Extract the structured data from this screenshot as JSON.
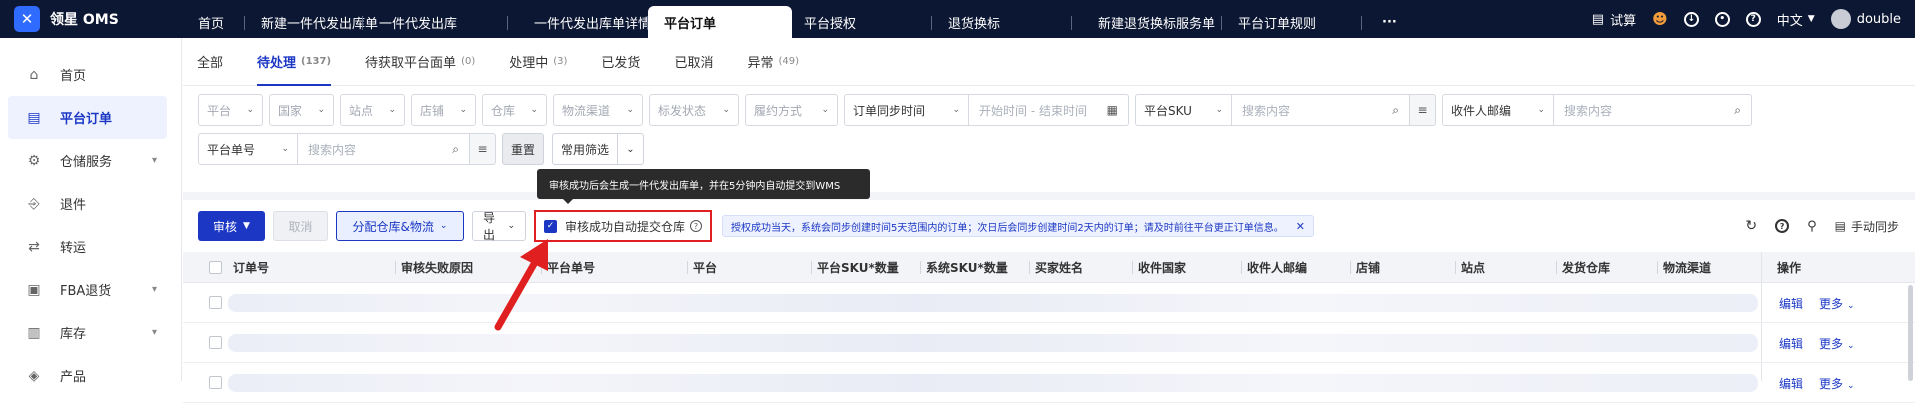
{
  "app": {
    "name": "领星 OMS",
    "logo_icon": "lingxing-logo-icon"
  },
  "topbar": {
    "tabs": [
      "首页",
      "新建一件代发出库单",
      "一件代发出库",
      "一件代发出库单详情",
      "平台订单",
      "平台授权",
      "退货换标",
      "新建退货换标服务单",
      "平台订单规则",
      "···"
    ],
    "active_tab": "平台订单",
    "trial_label": "试算",
    "lang_label": "中文",
    "user_name": "double"
  },
  "sidebar": {
    "items": [
      {
        "label": "首页",
        "icon": "home-icon",
        "expandable": false
      },
      {
        "label": "平台订单",
        "icon": "document-icon",
        "expandable": false,
        "active": true
      },
      {
        "label": "仓储服务",
        "icon": "warehouse-icon",
        "expandable": true
      },
      {
        "label": "退件",
        "icon": "return-icon",
        "expandable": false
      },
      {
        "label": "转运",
        "icon": "transfer-icon",
        "expandable": false
      },
      {
        "label": "FBA退货",
        "icon": "fba-icon",
        "expandable": true
      },
      {
        "label": "库存",
        "icon": "stock-icon",
        "expandable": true
      },
      {
        "label": "产品",
        "icon": "product-icon",
        "expandable": false
      }
    ]
  },
  "status_tabs": [
    {
      "label": "全部",
      "count": ""
    },
    {
      "label": "待处理",
      "count": "(137)",
      "active": true
    },
    {
      "label": "待获取平台面单",
      "count": "(0)"
    },
    {
      "label": "处理中",
      "count": "(3)"
    },
    {
      "label": "已发货",
      "count": ""
    },
    {
      "label": "已取消",
      "count": ""
    },
    {
      "label": "异常",
      "count": "(49)"
    }
  ],
  "filters": {
    "platform": "平台",
    "country": "国家",
    "site": "站点",
    "store": "店铺",
    "warehouse": "仓库",
    "logistics": "物流渠道",
    "label_status": "标发状态",
    "fulfill_method": "履约方式",
    "sync_time": "订单同步时间",
    "time_range": "开始时间 - 结束时间",
    "platform_sku": "平台SKU",
    "search_placeholder": "搜索内容",
    "receiver_email": "收件人邮编",
    "platform_order_no": "平台单号",
    "reset": "重置",
    "common_filter": "常用筛选"
  },
  "toolbar": {
    "audit": "审核",
    "cancel": "取消",
    "assign": "分配仓库&物流",
    "export": "导出",
    "auto_submit_label": "审核成功自动提交仓库",
    "auto_submit_checked": true,
    "notice": "授权成功当天，系统会同步创建时间5天范围内的订单；次日后会同步创建时间2天内的订单；请及时前往平台更正订单信息。",
    "manual_sync": "手动同步"
  },
  "tooltip": "审核成功后会生成一件代发出库单，并在5分钟内自动提交到WMS",
  "table": {
    "columns": [
      "订单号",
      "审核失败原因",
      "平台单号",
      "平台",
      "平台SKU*数量",
      "系统SKU*数量",
      "买家姓名",
      "收件国家",
      "收件人邮编",
      "店铺",
      "站点",
      "发货仓库",
      "物流渠道",
      "操作"
    ],
    "rows": [
      {
        "edit": "编辑",
        "more": "更多"
      },
      {
        "edit": "编辑",
        "more": "更多"
      },
      {
        "edit": "编辑",
        "more": "更多"
      }
    ]
  },
  "colors": {
    "topbar": "#0c1733",
    "accent": "#1b37c4",
    "highlight_border": "#e02020",
    "arrow": "#e02020"
  }
}
